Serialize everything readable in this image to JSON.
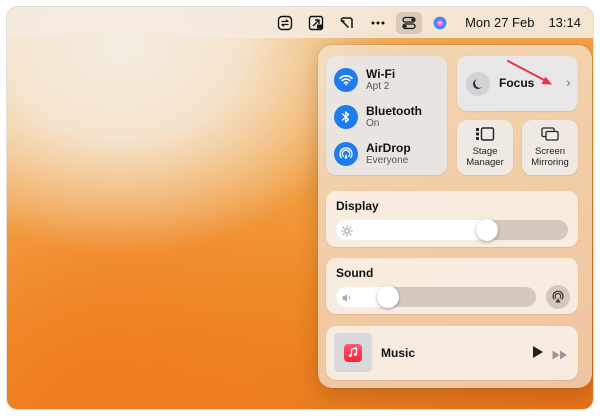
{
  "menubar": {
    "icons": [
      "sync-icon",
      "screen-sharing-icon",
      "stage-icon",
      "more-icon",
      "control-center-icon",
      "siri-icon"
    ],
    "date": "Mon 27 Feb",
    "time": "13:14"
  },
  "control_center": {
    "wifi": {
      "title": "Wi-Fi",
      "subtitle": "Apt 2",
      "icon": "wifi-icon"
    },
    "bluetooth": {
      "title": "Bluetooth",
      "subtitle": "On",
      "icon": "bluetooth-icon"
    },
    "airdrop": {
      "title": "AirDrop",
      "subtitle": "Everyone",
      "icon": "airdrop-icon"
    },
    "focus": {
      "label": "Focus",
      "icon": "moon-icon"
    },
    "stage_manager": {
      "label_line1": "Stage",
      "label_line2": "Manager",
      "icon": "stage-manager-icon"
    },
    "screen_mirroring": {
      "label_line1": "Screen",
      "label_line2": "Mirroring",
      "icon": "screen-mirroring-icon"
    },
    "display": {
      "title": "Display",
      "level": 0.65,
      "icon": "sun-icon"
    },
    "sound": {
      "title": "Sound",
      "level": 0.26,
      "icon": "speaker-icon"
    },
    "music": {
      "label": "Music",
      "icon": "music-note-icon"
    }
  },
  "colors": {
    "accent": "#1e7bf0",
    "annotation_arrow": "#e8344b",
    "music_app": "#fa233b"
  }
}
